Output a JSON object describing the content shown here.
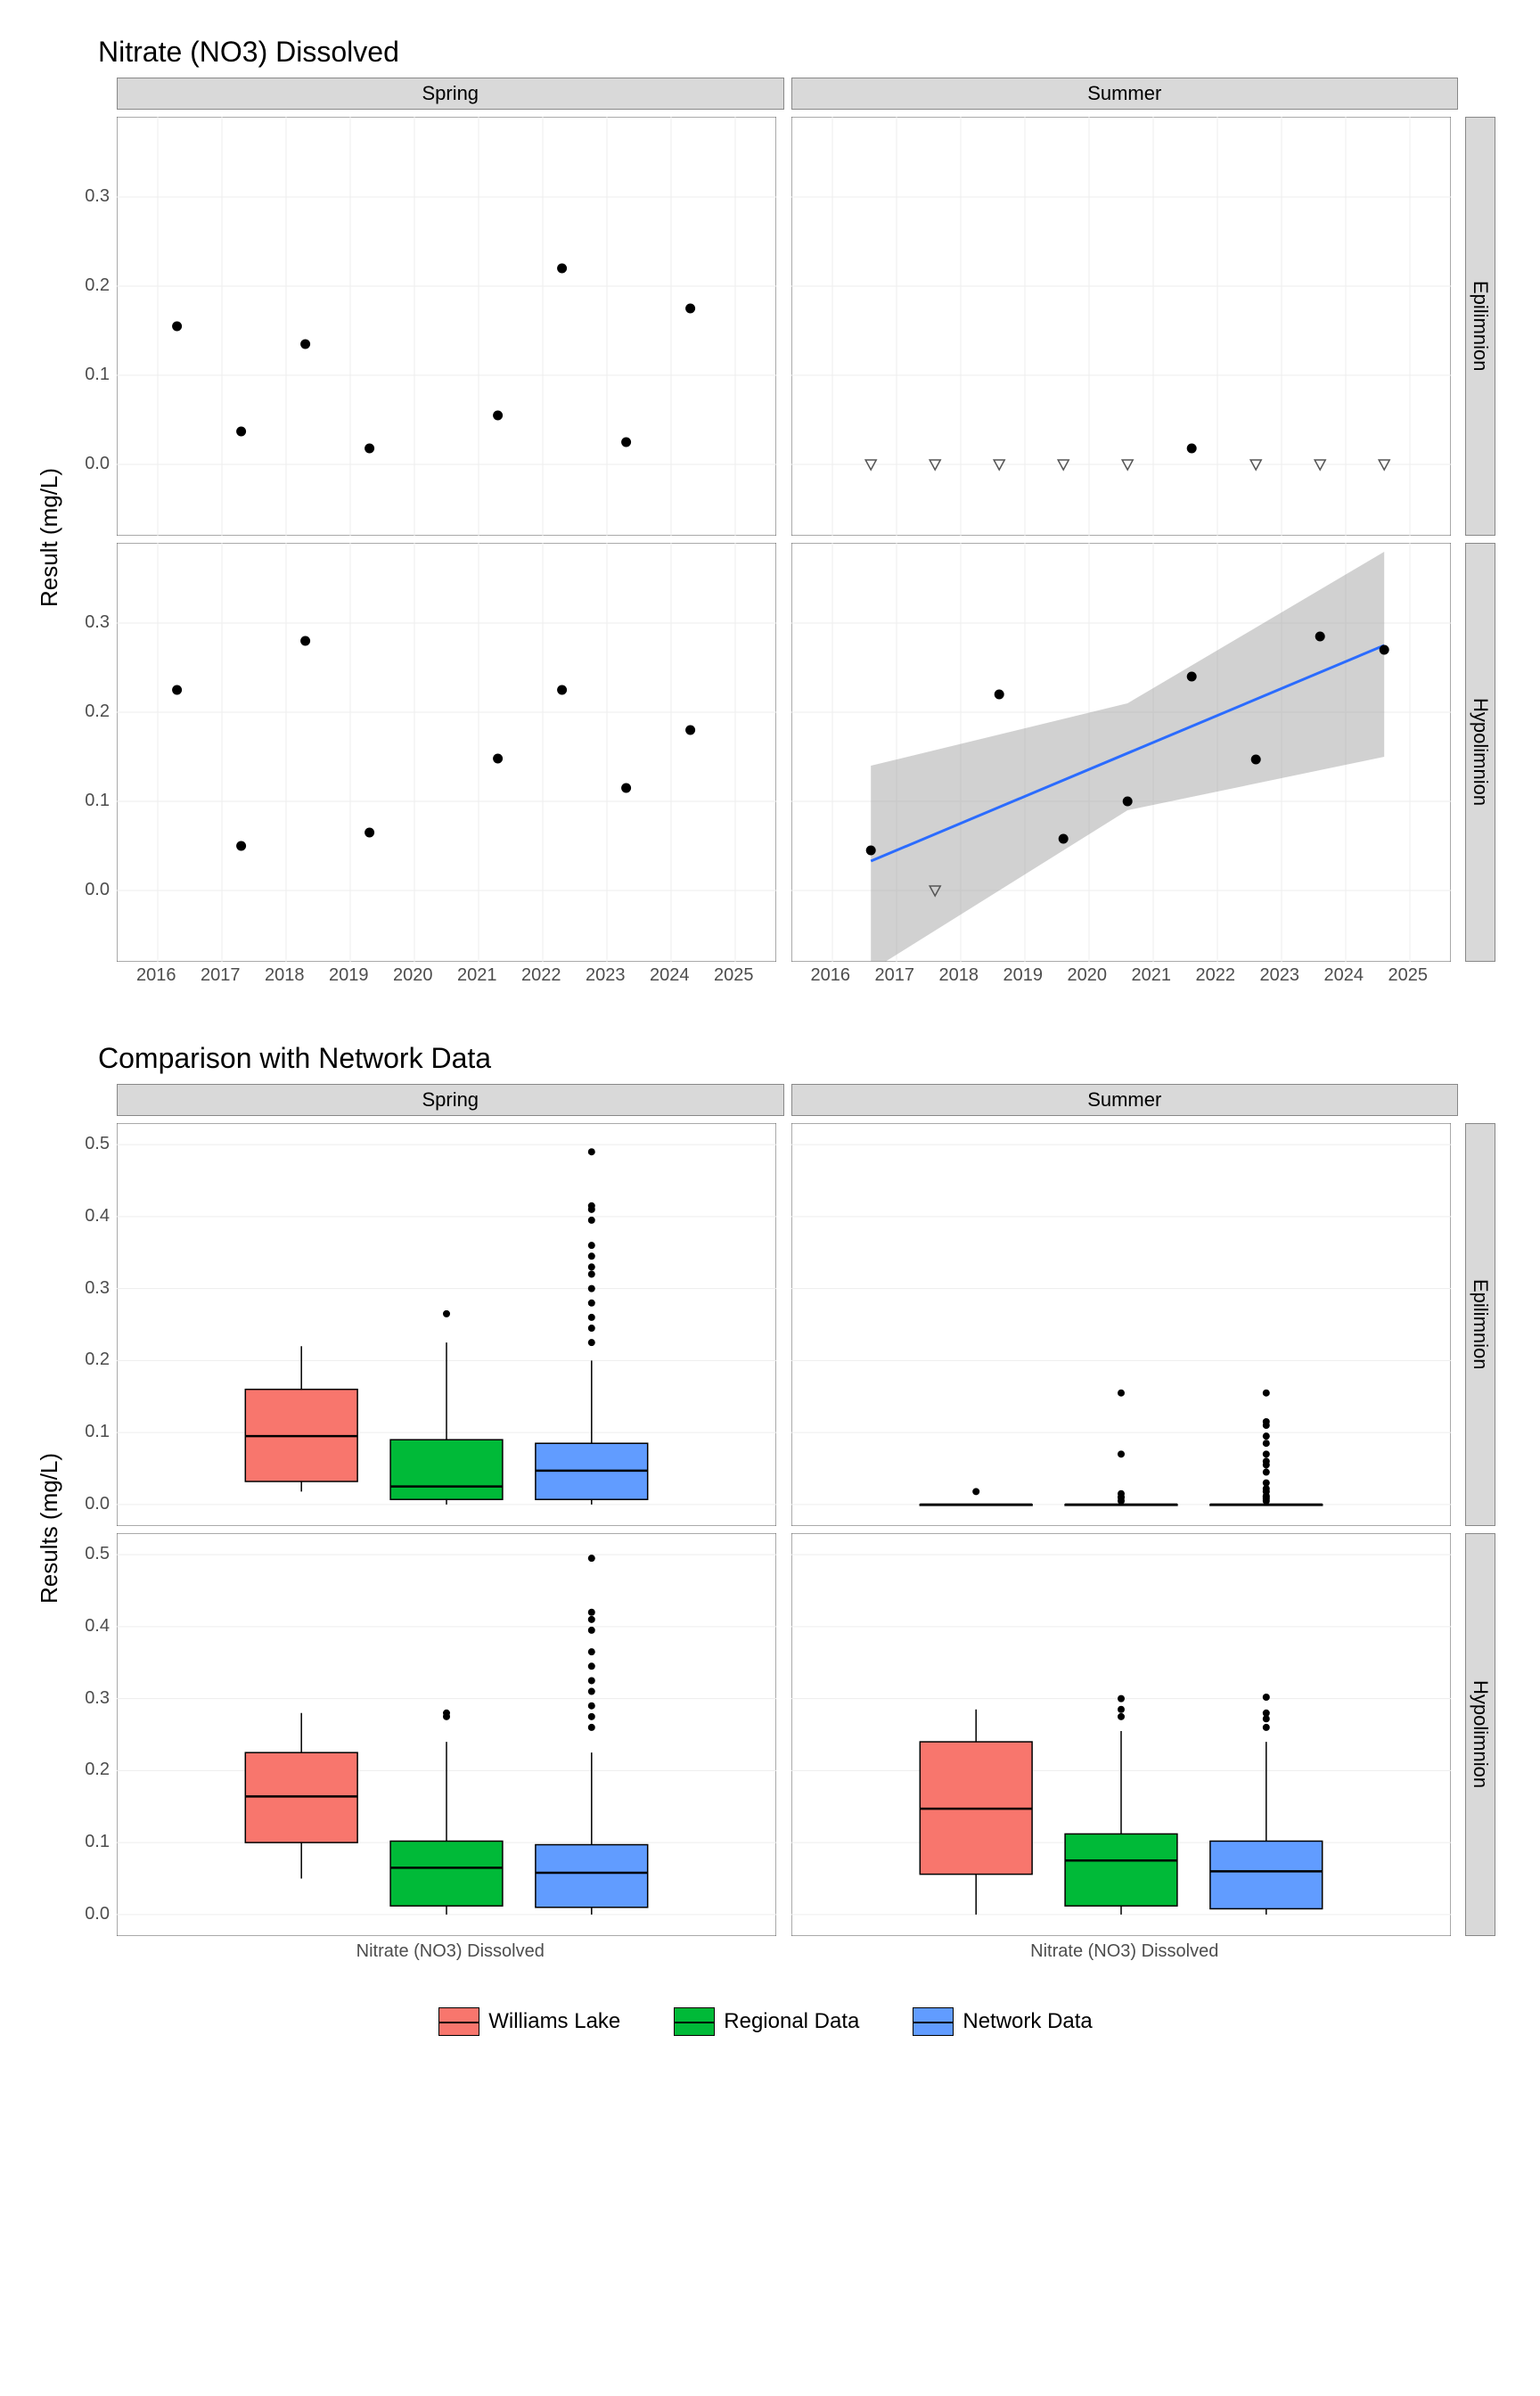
{
  "chart_data": [
    {
      "type": "scatter",
      "title": "Nitrate (NO3) Dissolved",
      "ylabel": "Result (mg/L)",
      "xlabel": "",
      "xticks": [
        2016,
        2017,
        2018,
        2019,
        2020,
        2021,
        2022,
        2023,
        2024,
        2025
      ],
      "yticks": [
        0.0,
        0.1,
        0.2,
        0.3
      ],
      "panels": [
        {
          "col": "Spring",
          "row": "Epilimnion",
          "points": [
            {
              "x": 2016.3,
              "y": 0.155,
              "nd": false
            },
            {
              "x": 2017.3,
              "y": 0.037,
              "nd": false
            },
            {
              "x": 2018.3,
              "y": 0.135,
              "nd": false
            },
            {
              "x": 2019.3,
              "y": 0.018,
              "nd": false
            },
            {
              "x": 2021.3,
              "y": 0.055,
              "nd": false
            },
            {
              "x": 2022.3,
              "y": 0.22,
              "nd": false
            },
            {
              "x": 2023.3,
              "y": 0.025,
              "nd": false
            },
            {
              "x": 2024.3,
              "y": 0.175,
              "nd": false
            }
          ]
        },
        {
          "col": "Summer",
          "row": "Epilimnion",
          "points": [
            {
              "x": 2016.6,
              "y": 0.0,
              "nd": true
            },
            {
              "x": 2017.6,
              "y": 0.0,
              "nd": true
            },
            {
              "x": 2018.6,
              "y": 0.0,
              "nd": true
            },
            {
              "x": 2019.6,
              "y": 0.0,
              "nd": true
            },
            {
              "x": 2020.6,
              "y": 0.0,
              "nd": true
            },
            {
              "x": 2021.6,
              "y": 0.018,
              "nd": false
            },
            {
              "x": 2022.6,
              "y": 0.0,
              "nd": true
            },
            {
              "x": 2023.6,
              "y": 0.0,
              "nd": true
            },
            {
              "x": 2024.6,
              "y": 0.0,
              "nd": true
            }
          ]
        },
        {
          "col": "Spring",
          "row": "Hypolimnion",
          "points": [
            {
              "x": 2016.3,
              "y": 0.225,
              "nd": false
            },
            {
              "x": 2017.3,
              "y": 0.05,
              "nd": false
            },
            {
              "x": 2018.3,
              "y": 0.28,
              "nd": false
            },
            {
              "x": 2019.3,
              "y": 0.065,
              "nd": false
            },
            {
              "x": 2021.3,
              "y": 0.148,
              "nd": false
            },
            {
              "x": 2022.3,
              "y": 0.225,
              "nd": false
            },
            {
              "x": 2023.3,
              "y": 0.115,
              "nd": false
            },
            {
              "x": 2024.3,
              "y": 0.18,
              "nd": false
            }
          ]
        },
        {
          "col": "Summer",
          "row": "Hypolimnion",
          "trend": {
            "x0": 2016.6,
            "y0": 0.033,
            "x1": 2024.6,
            "y1": 0.275,
            "ci": [
              [
                2016.6,
                -0.09,
                0.14
              ],
              [
                2020.6,
                0.09,
                0.21
              ],
              [
                2024.6,
                0.15,
                0.38
              ]
            ]
          },
          "points": [
            {
              "x": 2016.6,
              "y": 0.045,
              "nd": false
            },
            {
              "x": 2017.6,
              "y": 0.0,
              "nd": true
            },
            {
              "x": 2018.6,
              "y": 0.22,
              "nd": false
            },
            {
              "x": 2019.6,
              "y": 0.058,
              "nd": false
            },
            {
              "x": 2020.6,
              "y": 0.1,
              "nd": false
            },
            {
              "x": 2021.6,
              "y": 0.24,
              "nd": false
            },
            {
              "x": 2022.6,
              "y": 0.147,
              "nd": false
            },
            {
              "x": 2023.6,
              "y": 0.285,
              "nd": false
            },
            {
              "x": 2024.6,
              "y": 0.27,
              "nd": false
            }
          ]
        }
      ]
    },
    {
      "type": "boxplot",
      "title": "Comparison with Network Data",
      "ylabel": "Results (mg/L)",
      "xlabel": "",
      "xtick_label": "Nitrate (NO3) Dissolved",
      "yticks": [
        0.0,
        0.1,
        0.2,
        0.3,
        0.4,
        0.5
      ],
      "groups": [
        "Williams Lake",
        "Regional Data",
        "Network Data"
      ],
      "colors": {
        "Williams Lake": "#F8766D",
        "Regional Data": "#00BA38",
        "Network Data": "#619CFF"
      },
      "panels": [
        {
          "col": "Spring",
          "row": "Epilimnion",
          "boxes": [
            {
              "g": "Williams Lake",
              "min": 0.018,
              "q1": 0.032,
              "med": 0.095,
              "q3": 0.16,
              "max": 0.22,
              "out": []
            },
            {
              "g": "Regional Data",
              "min": 0.0,
              "q1": 0.007,
              "med": 0.025,
              "q3": 0.09,
              "max": 0.225,
              "out": [
                0.265
              ]
            },
            {
              "g": "Network Data",
              "min": 0.0,
              "q1": 0.007,
              "med": 0.047,
              "q3": 0.085,
              "max": 0.2,
              "out": [
                0.225,
                0.245,
                0.26,
                0.28,
                0.3,
                0.32,
                0.33,
                0.345,
                0.36,
                0.395,
                0.41,
                0.415,
                0.49
              ]
            }
          ]
        },
        {
          "col": "Summer",
          "row": "Epilimnion",
          "boxes": [
            {
              "g": "Williams Lake",
              "min": 0.0,
              "q1": 0.0,
              "med": 0.0,
              "q3": 0.0,
              "max": 0.0,
              "out": [
                0.018
              ]
            },
            {
              "g": "Regional Data",
              "min": 0.0,
              "q1": 0.0,
              "med": 0.0,
              "q3": 0.0,
              "max": 0.0,
              "out": [
                0.005,
                0.01,
                0.01,
                0.015,
                0.07,
                0.155
              ]
            },
            {
              "g": "Network Data",
              "min": 0.0,
              "q1": 0.0,
              "med": 0.0,
              "q3": 0.0,
              "max": 0.0,
              "out": [
                0.005,
                0.008,
                0.01,
                0.012,
                0.018,
                0.022,
                0.03,
                0.045,
                0.055,
                0.06,
                0.07,
                0.085,
                0.095,
                0.11,
                0.115,
                0.155
              ]
            }
          ]
        },
        {
          "col": "Spring",
          "row": "Hypolimnion",
          "boxes": [
            {
              "g": "Williams Lake",
              "min": 0.05,
              "q1": 0.1,
              "med": 0.164,
              "q3": 0.225,
              "max": 0.28,
              "out": []
            },
            {
              "g": "Regional Data",
              "min": 0.0,
              "q1": 0.012,
              "med": 0.065,
              "q3": 0.102,
              "max": 0.24,
              "out": [
                0.275,
                0.28
              ]
            },
            {
              "g": "Network Data",
              "min": 0.0,
              "q1": 0.01,
              "med": 0.058,
              "q3": 0.097,
              "max": 0.225,
              "out": [
                0.26,
                0.275,
                0.29,
                0.31,
                0.325,
                0.345,
                0.365,
                0.395,
                0.41,
                0.42,
                0.495
              ]
            }
          ]
        },
        {
          "col": "Summer",
          "row": "Hypolimnion",
          "boxes": [
            {
              "g": "Williams Lake",
              "min": 0.0,
              "q1": 0.056,
              "med": 0.147,
              "q3": 0.24,
              "max": 0.285,
              "out": []
            },
            {
              "g": "Regional Data",
              "min": 0.0,
              "q1": 0.012,
              "med": 0.075,
              "q3": 0.112,
              "max": 0.255,
              "out": [
                0.275,
                0.285,
                0.3
              ]
            },
            {
              "g": "Network Data",
              "min": 0.0,
              "q1": 0.008,
              "med": 0.06,
              "q3": 0.102,
              "max": 0.24,
              "out": [
                0.26,
                0.272,
                0.28,
                0.302
              ]
            }
          ]
        }
      ]
    }
  ],
  "facets": {
    "cols": [
      "Spring",
      "Summer"
    ],
    "rows_top": [
      "Epilimnion",
      "Hypolimnion"
    ],
    "rows_bot": [
      "Epilimnion",
      "Hypolimnion"
    ]
  },
  "legend": [
    "Williams Lake",
    "Regional Data",
    "Network Data"
  ]
}
